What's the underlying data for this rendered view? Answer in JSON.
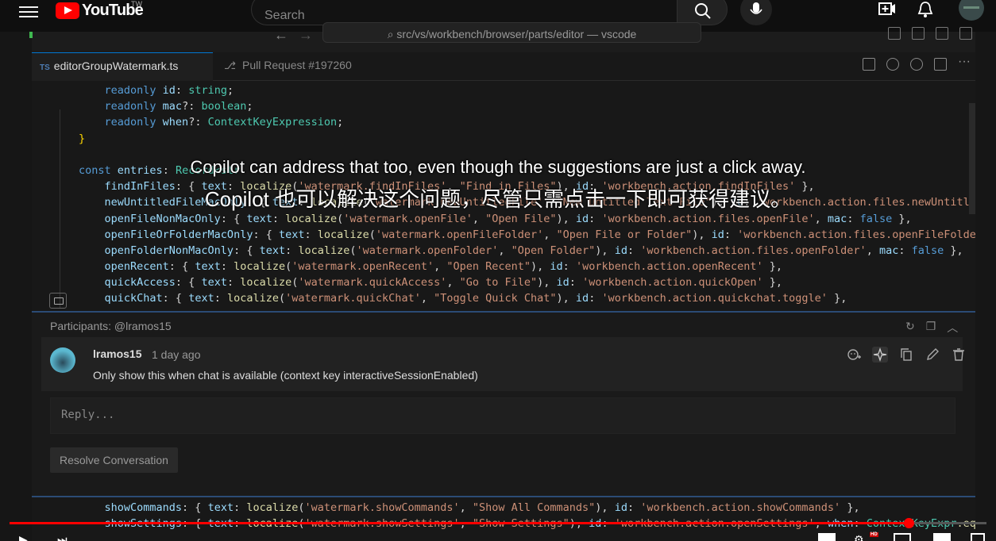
{
  "youtube": {
    "logo_text": "YouTube",
    "region": "TW",
    "search_placeholder": "Search"
  },
  "vscode": {
    "command_center": "src/vs/workbench/browser/parts/editor — vscode",
    "tabs": [
      {
        "badge": "TS",
        "label": "editorGroupWatermark.ts"
      },
      {
        "label": "Pull Request #197260"
      }
    ],
    "code_top": [
      [
        [
          "    readonly ",
          "k"
        ],
        [
          "id",
          "v"
        ],
        [
          ": ",
          "p"
        ],
        [
          "string",
          "t"
        ],
        [
          ";",
          "p"
        ]
      ],
      [
        [
          "    readonly ",
          "k"
        ],
        [
          "mac",
          "v"
        ],
        [
          "?: ",
          "p"
        ],
        [
          "boolean",
          "t"
        ],
        [
          ";",
          "p"
        ]
      ],
      [
        [
          "    readonly ",
          "k"
        ],
        [
          "when",
          "v"
        ],
        [
          "?: ",
          "p"
        ],
        [
          "ContextKeyExpression",
          "t"
        ],
        [
          ";",
          "p"
        ]
      ],
      [
        [
          "}",
          "b"
        ]
      ],
      [
        [
          "",
          ""
        ]
      ],
      [
        [
          "const ",
          "k"
        ],
        [
          "entries",
          "v"
        ],
        [
          ": ",
          "p"
        ],
        [
          "Record<str",
          "t"
        ]
      ],
      [
        [
          "    findInFiles",
          "v"
        ],
        [
          ": { ",
          "p"
        ],
        [
          "text",
          "v"
        ],
        [
          ": ",
          "p"
        ],
        [
          "localize",
          "f"
        ],
        [
          "(",
          "p"
        ],
        [
          "'watermark.findInFiles'",
          "s"
        ],
        [
          ", ",
          "p"
        ],
        [
          "\"Find in Files\"",
          "s"
        ],
        [
          "), ",
          "p"
        ],
        [
          "id",
          "v"
        ],
        [
          ": ",
          "p"
        ],
        [
          "'workbench.action.findInFiles'",
          "s"
        ],
        [
          " },",
          "p"
        ]
      ],
      [
        [
          "    newUntitledFileMacOnly",
          "v"
        ],
        [
          ": { ",
          "p"
        ],
        [
          "text",
          "v"
        ],
        [
          ": ",
          "p"
        ],
        [
          "localize",
          "f"
        ],
        [
          "(",
          "p"
        ],
        [
          "'watermark.newUntitledFile'",
          "s"
        ],
        [
          ", ",
          "p"
        ],
        [
          "\"New Untitled Text File\"",
          "s"
        ],
        [
          "), ",
          "p"
        ],
        [
          "id",
          "v"
        ],
        [
          ": ",
          "p"
        ],
        [
          "'workbench.action.files.newUntitledFil",
          "s"
        ]
      ],
      [
        [
          "    openFileNonMacOnly",
          "v"
        ],
        [
          ": { ",
          "p"
        ],
        [
          "text",
          "v"
        ],
        [
          ": ",
          "p"
        ],
        [
          "localize",
          "f"
        ],
        [
          "(",
          "p"
        ],
        [
          "'watermark.openFile'",
          "s"
        ],
        [
          ", ",
          "p"
        ],
        [
          "\"Open File\"",
          "s"
        ],
        [
          "), ",
          "p"
        ],
        [
          "id",
          "v"
        ],
        [
          ": ",
          "p"
        ],
        [
          "'workbench.action.files.openFile'",
          "s"
        ],
        [
          ", ",
          "p"
        ],
        [
          "mac",
          "v"
        ],
        [
          ": ",
          "p"
        ],
        [
          "false",
          "k"
        ],
        [
          " },",
          "p"
        ]
      ],
      [
        [
          "    openFileOrFolderMacOnly",
          "v"
        ],
        [
          ": { ",
          "p"
        ],
        [
          "text",
          "v"
        ],
        [
          ": ",
          "p"
        ],
        [
          "localize",
          "f"
        ],
        [
          "(",
          "p"
        ],
        [
          "'watermark.openFileFolder'",
          "s"
        ],
        [
          ", ",
          "p"
        ],
        [
          "\"Open File or Folder\"",
          "s"
        ],
        [
          "), ",
          "p"
        ],
        [
          "id",
          "v"
        ],
        [
          ": ",
          "p"
        ],
        [
          "'workbench.action.files.openFileFolder'",
          "s"
        ],
        [
          ",",
          "p"
        ]
      ],
      [
        [
          "    openFolderNonMacOnly",
          "v"
        ],
        [
          ": { ",
          "p"
        ],
        [
          "text",
          "v"
        ],
        [
          ": ",
          "p"
        ],
        [
          "localize",
          "f"
        ],
        [
          "(",
          "p"
        ],
        [
          "'watermark.openFolder'",
          "s"
        ],
        [
          ", ",
          "p"
        ],
        [
          "\"Open Folder\"",
          "s"
        ],
        [
          "), ",
          "p"
        ],
        [
          "id",
          "v"
        ],
        [
          ": ",
          "p"
        ],
        [
          "'workbench.action.files.openFolder'",
          "s"
        ],
        [
          ", ",
          "p"
        ],
        [
          "mac",
          "v"
        ],
        [
          ": ",
          "p"
        ],
        [
          "false",
          "k"
        ],
        [
          " },",
          "p"
        ]
      ],
      [
        [
          "    openRecent",
          "v"
        ],
        [
          ": { ",
          "p"
        ],
        [
          "text",
          "v"
        ],
        [
          ": ",
          "p"
        ],
        [
          "localize",
          "f"
        ],
        [
          "(",
          "p"
        ],
        [
          "'watermark.openRecent'",
          "s"
        ],
        [
          ", ",
          "p"
        ],
        [
          "\"Open Recent\"",
          "s"
        ],
        [
          "), ",
          "p"
        ],
        [
          "id",
          "v"
        ],
        [
          ": ",
          "p"
        ],
        [
          "'workbench.action.openRecent'",
          "s"
        ],
        [
          " },",
          "p"
        ]
      ],
      [
        [
          "    quickAccess",
          "v"
        ],
        [
          ": { ",
          "p"
        ],
        [
          "text",
          "v"
        ],
        [
          ": ",
          "p"
        ],
        [
          "localize",
          "f"
        ],
        [
          "(",
          "p"
        ],
        [
          "'watermark.quickAccess'",
          "s"
        ],
        [
          ", ",
          "p"
        ],
        [
          "\"Go to File\"",
          "s"
        ],
        [
          "), ",
          "p"
        ],
        [
          "id",
          "v"
        ],
        [
          ": ",
          "p"
        ],
        [
          "'workbench.action.quickOpen'",
          "s"
        ],
        [
          " },",
          "p"
        ]
      ],
      [
        [
          "    quickChat",
          "v"
        ],
        [
          ": { ",
          "p"
        ],
        [
          "text",
          "v"
        ],
        [
          ": ",
          "p"
        ],
        [
          "localize",
          "f"
        ],
        [
          "(",
          "p"
        ],
        [
          "'watermark.quickChat'",
          "s"
        ],
        [
          ", ",
          "p"
        ],
        [
          "\"Toggle Quick Chat\"",
          "s"
        ],
        [
          "), ",
          "p"
        ],
        [
          "id",
          "v"
        ],
        [
          ": ",
          "p"
        ],
        [
          "'workbench.action.quickchat.toggle'",
          "s"
        ],
        [
          " },",
          "p"
        ]
      ]
    ],
    "code_bottom": [
      [
        [
          "    showCommands",
          "v"
        ],
        [
          ": { ",
          "p"
        ],
        [
          "text",
          "v"
        ],
        [
          ": ",
          "p"
        ],
        [
          "localize",
          "f"
        ],
        [
          "(",
          "p"
        ],
        [
          "'watermark.showCommands'",
          "s"
        ],
        [
          ", ",
          "p"
        ],
        [
          "\"Show All Commands\"",
          "s"
        ],
        [
          "), ",
          "p"
        ],
        [
          "id",
          "v"
        ],
        [
          ": ",
          "p"
        ],
        [
          "'workbench.action.showCommands'",
          "s"
        ],
        [
          " },",
          "p"
        ]
      ],
      [
        [
          "    showSettings",
          "v"
        ],
        [
          ": { ",
          "p"
        ],
        [
          "text",
          "v"
        ],
        [
          ": ",
          "p"
        ],
        [
          "localize",
          "f"
        ],
        [
          "(",
          "p"
        ],
        [
          "'watermark.showSettings'",
          "s"
        ],
        [
          ", ",
          "p"
        ],
        [
          "\"Show Settings\"",
          "s"
        ],
        [
          "), ",
          "p"
        ],
        [
          "id",
          "v"
        ],
        [
          ": ",
          "p"
        ],
        [
          "'workbench.action.openSettings'",
          "s"
        ],
        [
          ", ",
          "p"
        ],
        [
          "when",
          "v"
        ],
        [
          ": ",
          "p"
        ],
        [
          "ContextKeyExpr",
          "t"
        ],
        [
          ".equals",
          "f"
        ]
      ]
    ],
    "comment_thread": {
      "participants": "Participants: @lramos15",
      "author": "lramos15",
      "time": "1 day ago",
      "body": "Only show this when chat is available (context key interactiveSessionEnabled)",
      "reply_placeholder": "Reply...",
      "resolve_label": "Resolve Conversation"
    }
  },
  "subtitles": {
    "en": "Copilot can address that too, even though the suggestions are just a click away.",
    "zh": "Copilot 也可以解决这个问题，尽管只需点击一下即可获得建议。"
  },
  "player": {
    "progress_fraction": 0.92
  }
}
